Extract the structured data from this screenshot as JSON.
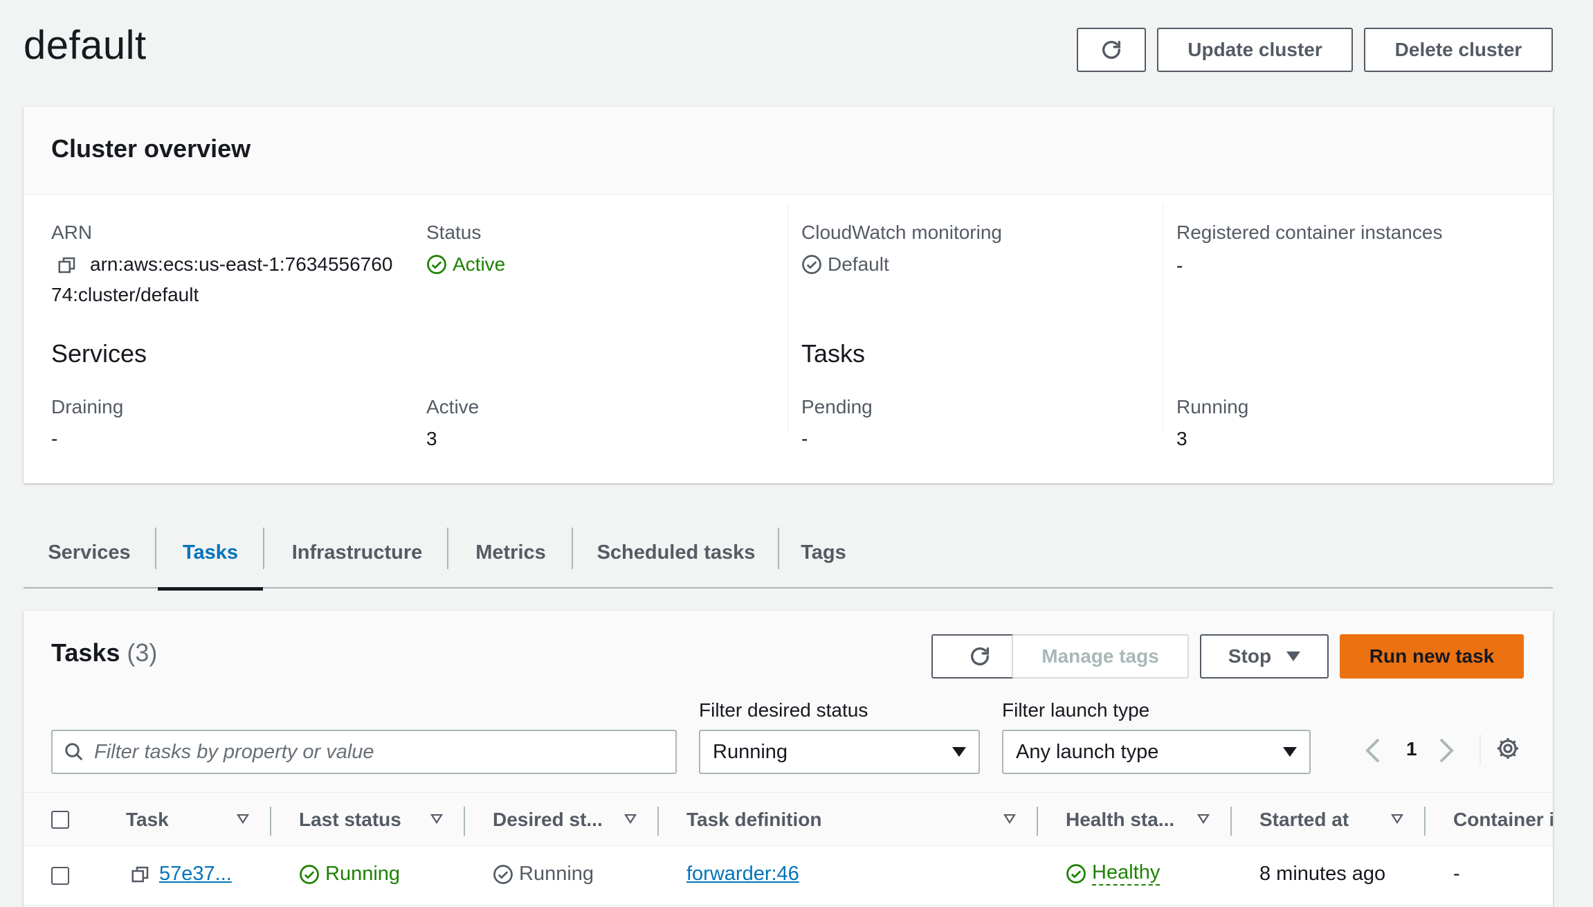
{
  "page": {
    "title": "default"
  },
  "header_buttons": {
    "update": "Update cluster",
    "delete": "Delete cluster"
  },
  "overview": {
    "title": "Cluster overview",
    "arn_label": "ARN",
    "arn_line1": "arn:aws:ecs:us-east-1:7634556760",
    "arn_line2": "74:cluster/default",
    "status_label": "Status",
    "status_value": "Active",
    "cloudwatch_label": "CloudWatch monitoring",
    "cloudwatch_value": "Default",
    "registered_label": "Registered container instances",
    "registered_value": "-",
    "services_heading": "Services",
    "draining_label": "Draining",
    "draining_value": "-",
    "active_label": "Active",
    "active_value": "3",
    "tasks_heading": "Tasks",
    "pending_label": "Pending",
    "pending_value": "-",
    "running_label": "Running",
    "running_value": "3"
  },
  "tabs": [
    {
      "label": "Services"
    },
    {
      "label": "Tasks",
      "active": true
    },
    {
      "label": "Infrastructure"
    },
    {
      "label": "Metrics"
    },
    {
      "label": "Scheduled tasks"
    },
    {
      "label": "Tags"
    }
  ],
  "tasks_panel": {
    "title": "Tasks",
    "count": "(3)",
    "manage_tags": "Manage tags",
    "stop": "Stop",
    "run_new_task": "Run new task",
    "filter_status_label": "Filter desired status",
    "filter_status_value": "Running",
    "filter_launch_label": "Filter launch type",
    "filter_launch_value": "Any launch type",
    "search_placeholder": "Filter tasks by property or value",
    "page_number": "1"
  },
  "table": {
    "columns": [
      "Task",
      "Last status",
      "Desired st...",
      "Task definition",
      "Health sta...",
      "Started at",
      "Container i"
    ],
    "rows": [
      {
        "task": "57e37...",
        "last_status": "Running",
        "desired_status": "Running",
        "task_definition": "forwarder:46",
        "health": "Healthy",
        "started_at": "8 minutes ago",
        "container": "-"
      }
    ]
  },
  "colors": {
    "accent": "#0073bb",
    "success": "#1d8102",
    "primary_button": "#ec7211",
    "text": "#16191f",
    "muted": "#545b64"
  }
}
